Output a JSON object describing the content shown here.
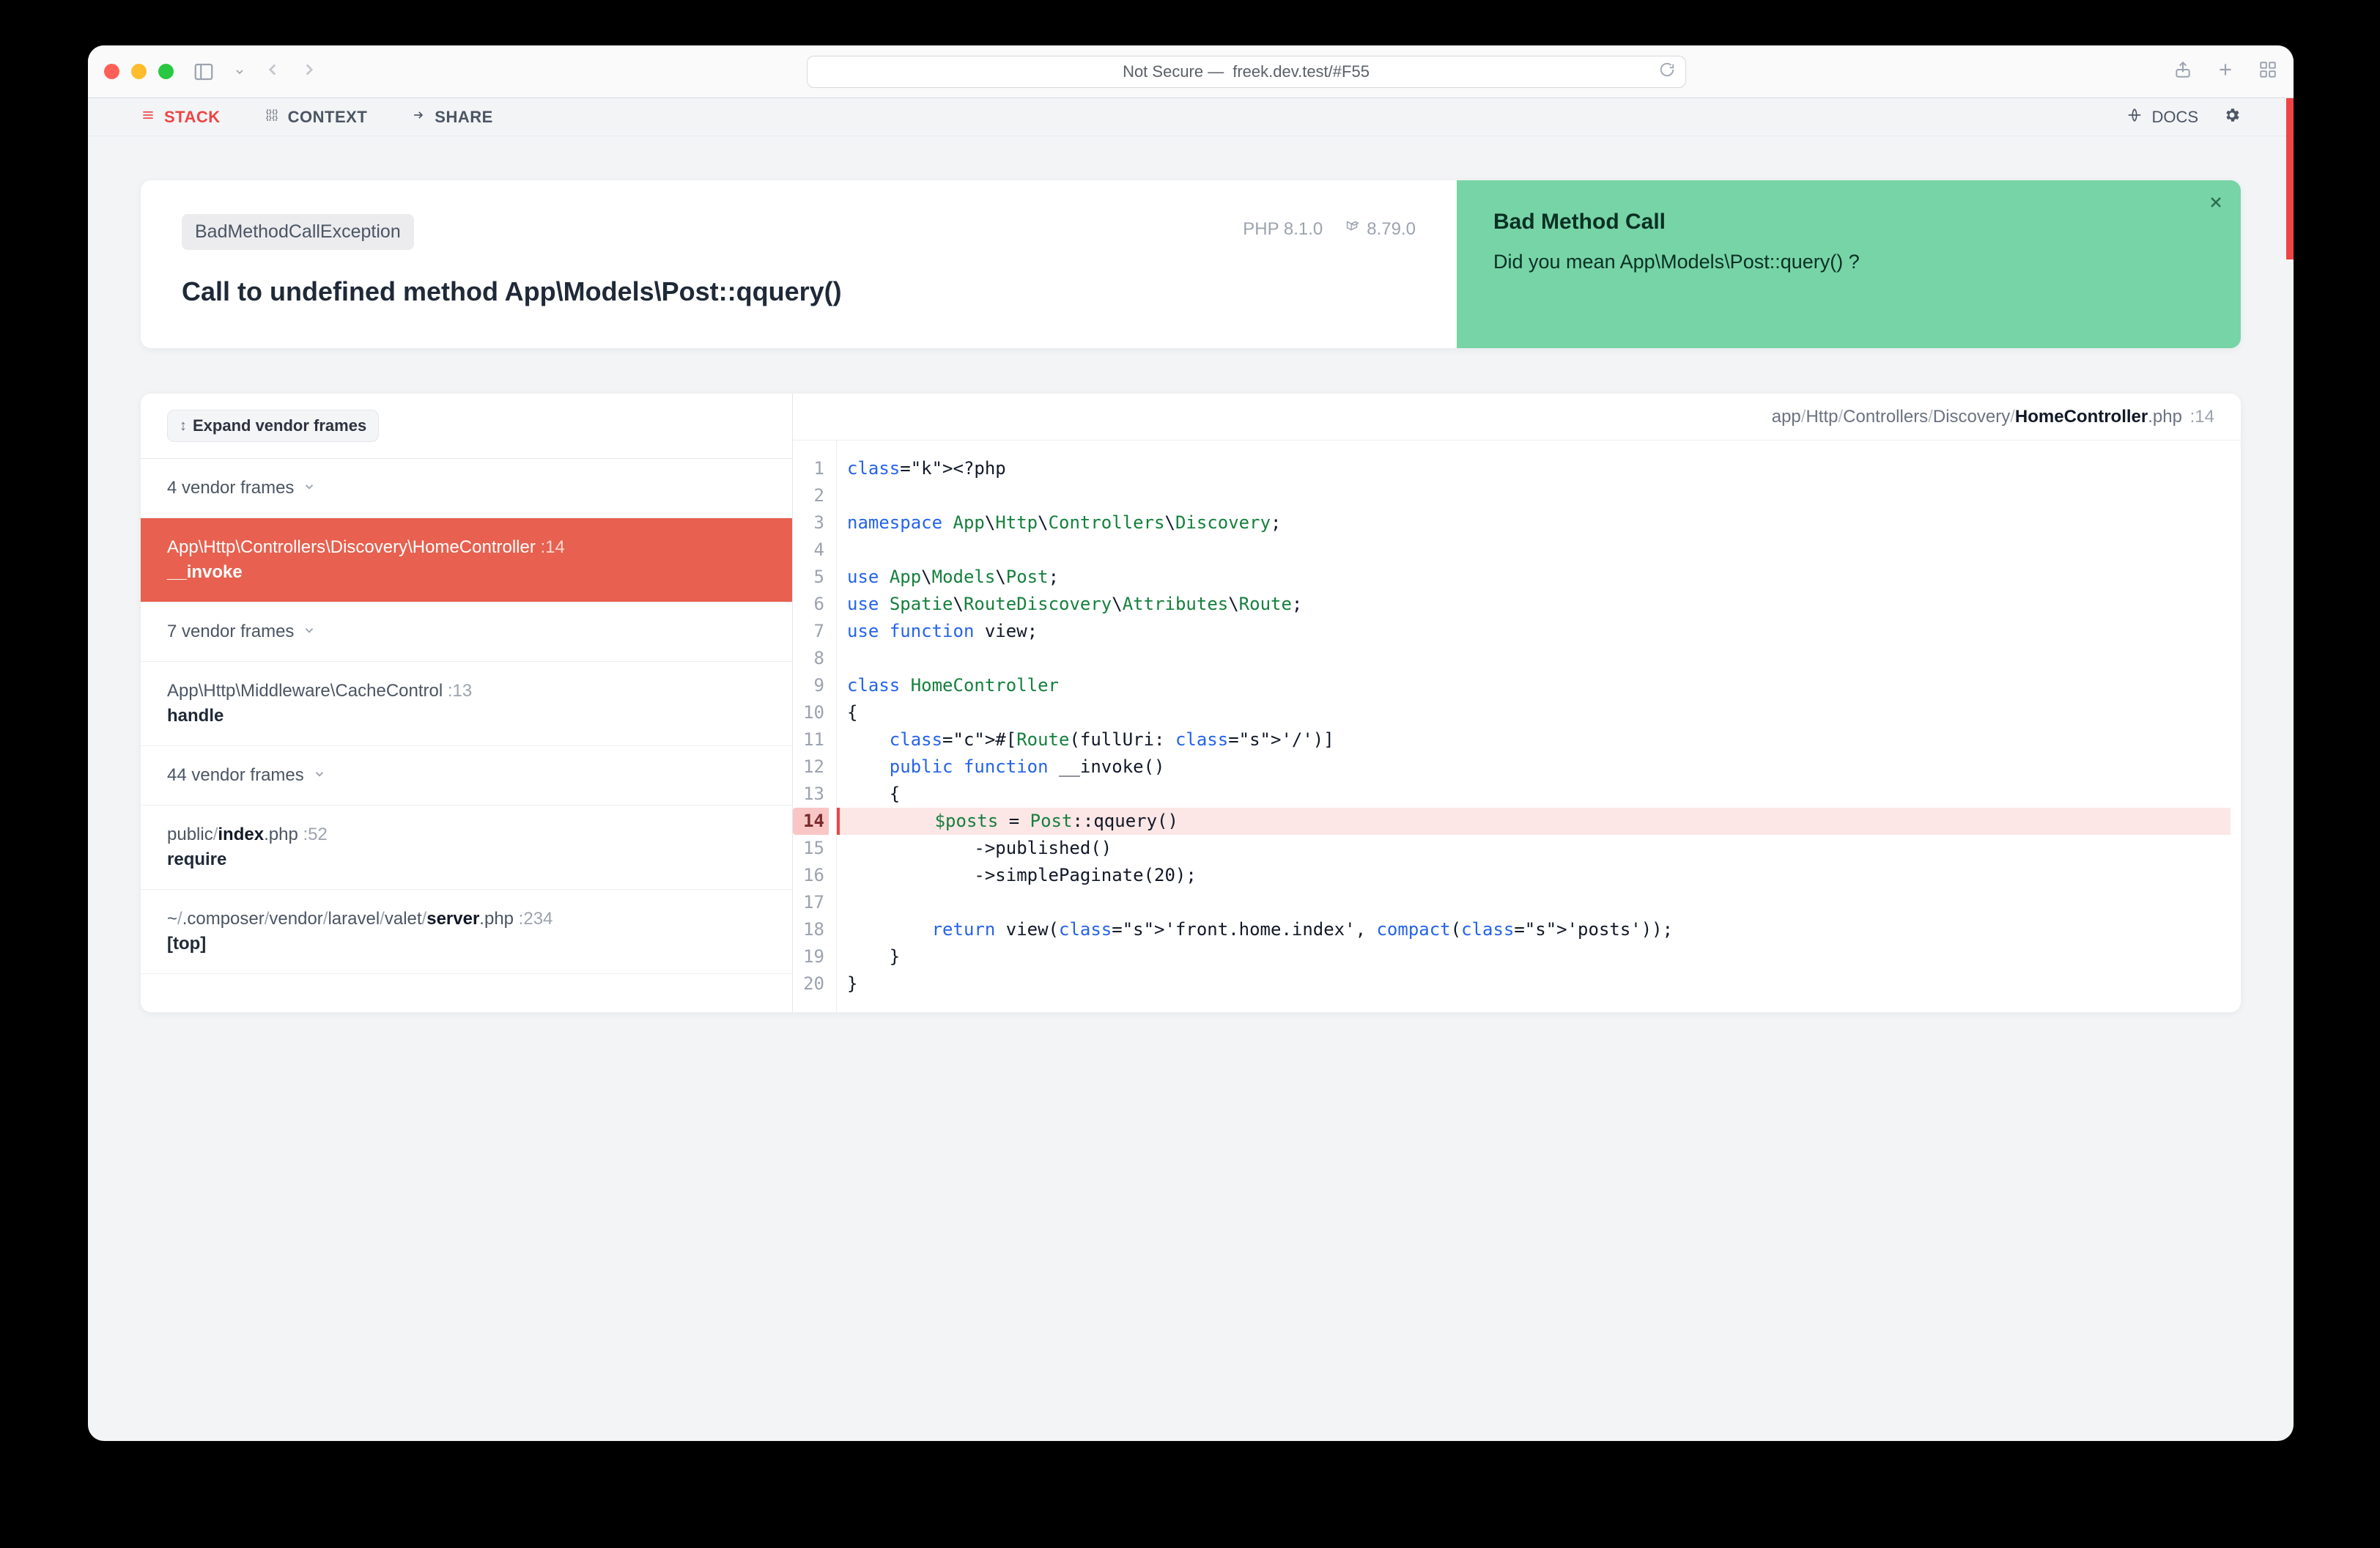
{
  "browser": {
    "address_prefix": "Not Secure — ",
    "address": "freek.dev.test/#F55"
  },
  "top_nav": {
    "stack": "STACK",
    "context": "CONTEXT",
    "share": "SHARE",
    "docs": "DOCS"
  },
  "error": {
    "exception": "BadMethodCallException",
    "message": "Call to undefined method App\\Models\\Post::qquery()",
    "php_version": "PHP 8.1.0",
    "laravel_version": "8.79.0",
    "solution": {
      "title": "Bad Method Call",
      "body": "Did you mean App\\Models\\Post::query() ?"
    }
  },
  "frames": {
    "expand_label": "Expand vendor frames",
    "items": [
      {
        "kind": "group",
        "label": "4 vendor frames"
      },
      {
        "kind": "frame",
        "selected": true,
        "path": "App\\Http\\Controllers\\Discovery\\HomeController",
        "line": "14",
        "method": "__invoke"
      },
      {
        "kind": "group",
        "label": "7 vendor frames"
      },
      {
        "kind": "frame",
        "path": "App\\Http\\Middleware\\CacheControl",
        "line": "13",
        "method": "handle"
      },
      {
        "kind": "group",
        "label": "44 vendor frames"
      },
      {
        "kind": "frame",
        "path_html": "public/index.php",
        "line": "52",
        "method": "require"
      },
      {
        "kind": "frame",
        "path_html": "~/.composer/vendor/laravel/valet/server.php",
        "line": "234",
        "method": "[top]"
      }
    ]
  },
  "code": {
    "breadcrumb": [
      "app",
      "Http",
      "Controllers",
      "Discovery"
    ],
    "file": "HomeController",
    "ext": ".php",
    "line": "14",
    "first_line": 1,
    "highlight": 14,
    "lines": [
      "<?php",
      "",
      "namespace App\\Http\\Controllers\\Discovery;",
      "",
      "use App\\Models\\Post;",
      "use Spatie\\RouteDiscovery\\Attributes\\Route;",
      "use function view;",
      "",
      "class HomeController",
      "{",
      "    #[Route(fullUri: '/')]",
      "    public function __invoke()",
      "    {",
      "        $posts = Post::qquery()",
      "            ->published()",
      "            ->simplePaginate(20);",
      "",
      "        return view('front.home.index', compact('posts'));",
      "    }",
      "}"
    ]
  }
}
